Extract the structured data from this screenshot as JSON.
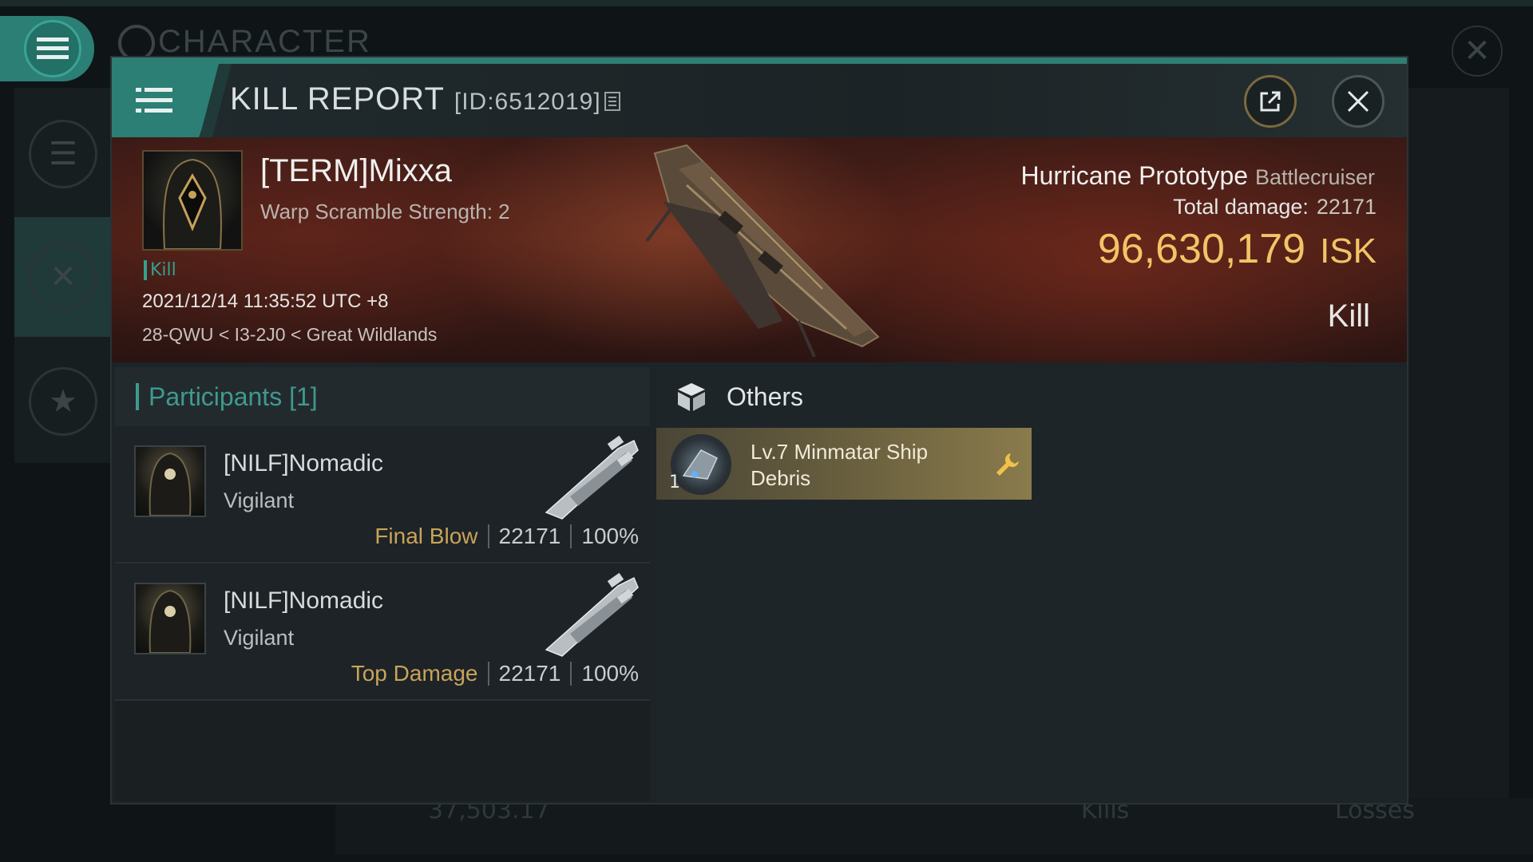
{
  "background": {
    "title": "CHARACTER",
    "bottom_value": "37,503.17",
    "bottom_kills": "Kills",
    "bottom_losses": "Losses"
  },
  "header": {
    "title": "KILL REPORT",
    "id_label": "[ID:6512019]"
  },
  "victim": {
    "name": "[TERM]Mixxa",
    "subtitle": "Warp Scramble Strength: 2",
    "tag": "Kill",
    "datetime": "2021/12/14 11:35:52 UTC +8",
    "location": "28-QWU < I3-2J0 < Great Wildlands",
    "ship_name": "Hurricane Prototype",
    "ship_class": "Battlecruiser",
    "total_damage_label": "Total damage:",
    "total_damage_value": "22171",
    "isk_value": "96,630,179",
    "isk_unit": "ISK",
    "result": "Kill"
  },
  "participants": {
    "title": "Participants [1]",
    "rows": [
      {
        "name": "[NILF]Nomadic",
        "ship": "Vigilant",
        "tag": "Final Blow",
        "damage": "22171",
        "percent": "100%"
      },
      {
        "name": "[NILF]Nomadic",
        "ship": "Vigilant",
        "tag": "Top Damage",
        "damage": "22171",
        "percent": "100%"
      }
    ]
  },
  "others": {
    "title": "Others",
    "items": [
      {
        "quantity": "1",
        "name": "Lv.7 Minmatar Ship Debris"
      }
    ]
  },
  "colors": {
    "accent": "#2b7f74",
    "isk_gold": "#f2c466",
    "participants_teal": "#3e9a8e",
    "tag_gold": "#c8a35a"
  },
  "icons": [
    "menu-icon",
    "share-icon",
    "close-icon",
    "copy-icon",
    "cube-icon",
    "wrench-icon",
    "swords-icon",
    "star-icon"
  ]
}
